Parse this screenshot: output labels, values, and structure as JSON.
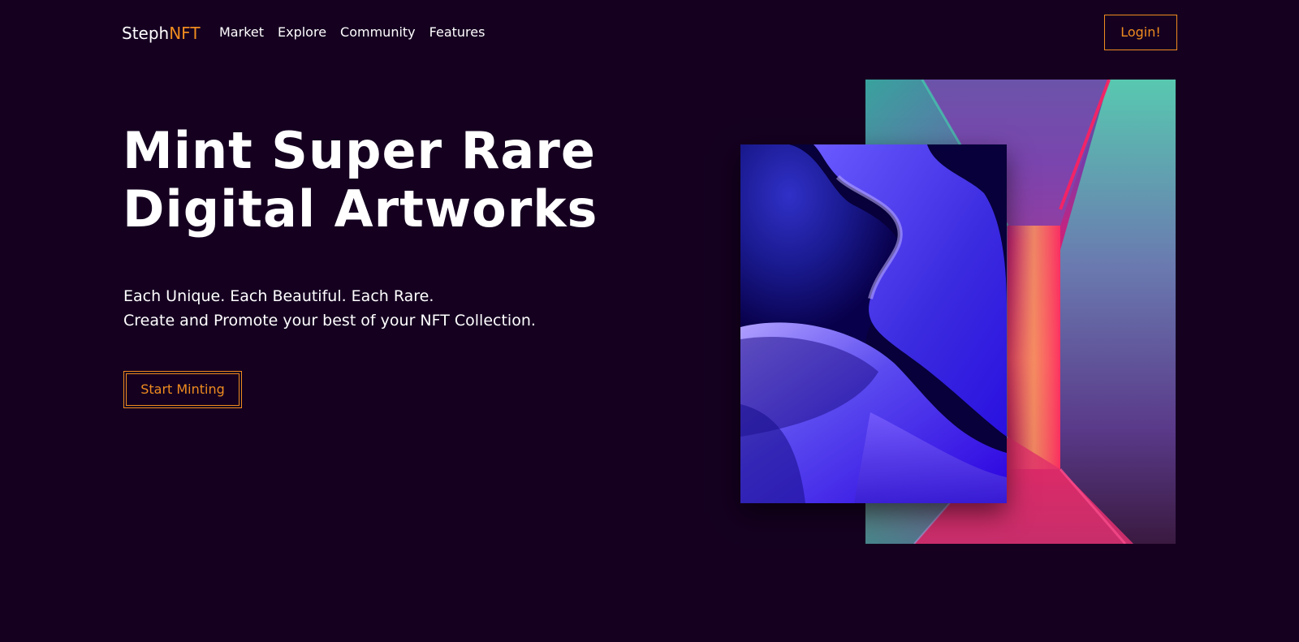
{
  "nav": {
    "brand_main": "Steph",
    "brand_accent": "NFT",
    "links": [
      "Market",
      "Explore",
      "Community",
      "Features"
    ],
    "login_label": "Login!"
  },
  "hero": {
    "title_line1": "Mint Super Rare",
    "title_line2": "Digital Artworks",
    "sub_line1": "Each Unique. Each Beautiful. Each Rare.",
    "sub_line2": "Create and Promote your best of your NFT Collection.",
    "cta_label": "Start Minting"
  },
  "colors": {
    "background": "#150020",
    "accent": "#ef8c1f",
    "text": "#ffffff"
  }
}
